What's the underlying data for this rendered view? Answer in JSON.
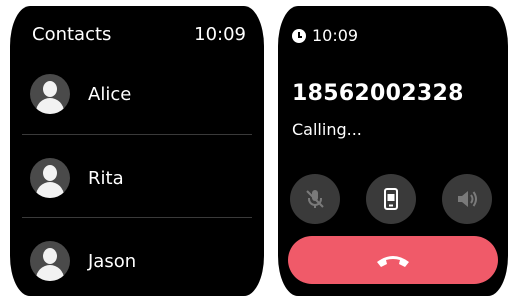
{
  "contacts_screen": {
    "title": "Contacts",
    "time": "10:09",
    "items": [
      {
        "name": "Alice"
      },
      {
        "name": "Rita"
      },
      {
        "name": "Jason"
      }
    ]
  },
  "call_screen": {
    "time": "10:09",
    "number": "18562002328",
    "status": "Calling...",
    "colors": {
      "end_call": "#f05a69",
      "button_bg": "#3a3a3a"
    },
    "icons": [
      "clock-icon",
      "mute-icon",
      "handset-icon",
      "speaker-icon",
      "end-call-icon"
    ]
  }
}
